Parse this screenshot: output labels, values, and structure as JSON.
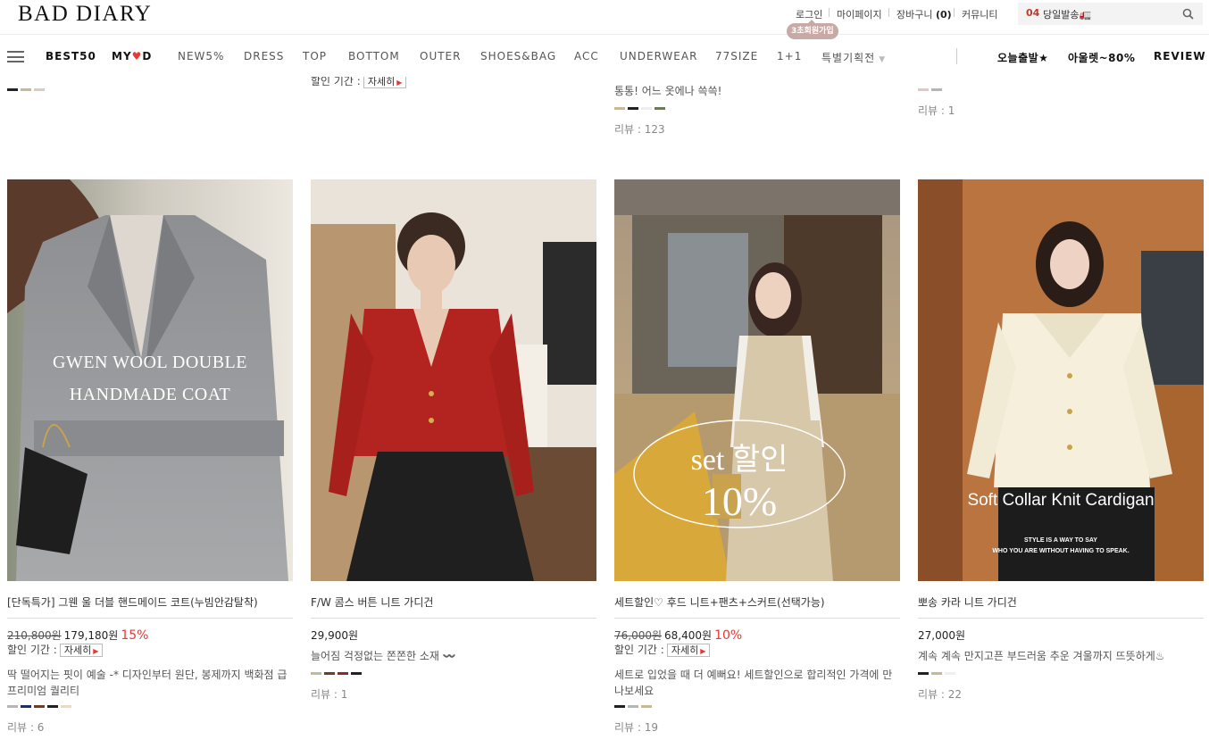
{
  "header": {
    "logo": "BAD DIARY",
    "util": {
      "login": "로그인",
      "mypage": "마이페이지",
      "cart": "장바구니",
      "cart_count": "(0)",
      "community": "커뮤니티"
    },
    "join_badge": "3초회원가입",
    "search": {
      "num": "04",
      "text": "당일발송🚛",
      "icon": "search-icon"
    }
  },
  "nav": {
    "items": [
      "BEST50",
      "MY",
      "D",
      "NEW5%",
      "DRESS",
      "TOP",
      "BOTTOM",
      "OUTER",
      "SHOES&BAG",
      "ACC",
      "UNDERWEAR",
      "77SIZE",
      "1+1",
      "특별기획전"
    ],
    "heart": "♥",
    "caret": "▼",
    "right": [
      "오늘출발★",
      "아울렛~80%",
      "REVIEW"
    ]
  },
  "top_row": {
    "col2_period": "할인 기간 :",
    "col2_detail": "자세히",
    "col3_desc": "통통! 어느 옷에나 쓱쓱!",
    "col3_review": "리뷰 : 123",
    "col4_review": "리뷰 : 1"
  },
  "products": [
    {
      "title": "[단독특가] 그웬 울 더블 핸드메이드 코트(누빔안감탈착)",
      "orig_price": "210,800원",
      "sale_price": "179,180원",
      "pct": "15%",
      "period": "할인 기간 :",
      "detail": "자세히",
      "desc1": "딱 떨어지는 핏이 예술 -* 디자인부터 원단, 봉제까지 백화점 급",
      "desc2": "프리미엄 퀄리티",
      "review": "리뷰 : 6",
      "overlay1": "GWEN WOOL DOUBLE",
      "overlay2": "HANDMADE COAT"
    },
    {
      "title": "F/W 콤스 버튼 니트 가디건",
      "price": "29,900원",
      "desc1": "늘어짐 걱정없는 쫀쫀한 소재 〰️",
      "review": "리뷰 : 1"
    },
    {
      "title": "세트할인♡ 후드 니트+팬츠+스커트(선택가능)",
      "orig_price": "76,000원",
      "sale_price": "68,400원",
      "pct": "10%",
      "period": "할인 기간 :",
      "detail": "자세히",
      "desc1": "세트로 입었을 때 더 예뻐요! 세트할인으로 합리적인 가격에 만",
      "desc2": "나보세요",
      "review": "리뷰 : 19",
      "overlay1": "set 할인",
      "overlay2": "10%"
    },
    {
      "title": "뽀송 카라 니트 가디건",
      "price": "27,000원",
      "desc1": "계속 계속 만지고픈 부드러움 추운 겨울까지 뜨뜻하게♨",
      "review": "리뷰 : 22",
      "overlay1": "Soft Collar Knit Cardigan",
      "overlay2": "STYLE IS A WAY TO SAY",
      "overlay3": "WHO YOU ARE WITHOUT HAVING TO SPEAK."
    }
  ],
  "colors": {
    "accent_red": "#e53935",
    "badge": "#c9a9a6",
    "swatch_black": "#222222",
    "swatch_beige": "#c8b89a",
    "swatch_pink": "#e3c6c6",
    "swatch_gray": "#b5b5b5",
    "swatch_green": "#6d7b5a",
    "swatch_navy": "#1f2f5c",
    "swatch_brown": "#6b3f2a",
    "swatch_wine": "#8b2a2a",
    "swatch_ivory": "#eeeeee"
  }
}
